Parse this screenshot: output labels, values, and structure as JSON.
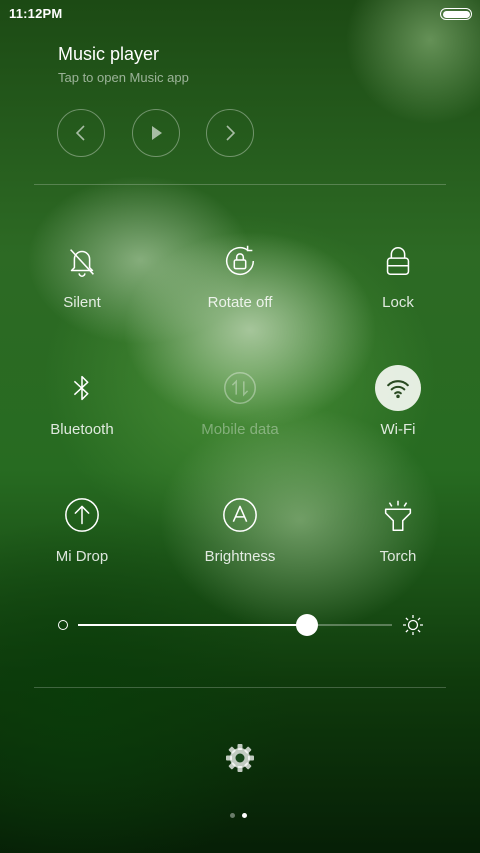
{
  "status_bar": {
    "time": "11:12PM",
    "battery_icon": "battery-full-icon"
  },
  "music": {
    "title": "Music player",
    "subtitle": "Tap to open Music app",
    "controls": [
      "previous-icon",
      "play-icon",
      "next-icon"
    ]
  },
  "tiles": [
    {
      "label": "Silent",
      "icon": "bell-off-icon",
      "state": "off"
    },
    {
      "label": "Rotate off",
      "icon": "rotate-lock-icon",
      "state": "off"
    },
    {
      "label": "Lock",
      "icon": "lock-icon",
      "state": "off"
    },
    {
      "label": "Bluetooth",
      "icon": "bluetooth-icon",
      "state": "off"
    },
    {
      "label": "Mobile data",
      "icon": "mobile-data-icon",
      "state": "disabled"
    },
    {
      "label": "Wi-Fi",
      "icon": "wifi-icon",
      "state": "on"
    },
    {
      "label": "Mi Drop",
      "icon": "mi-drop-icon",
      "state": "off"
    },
    {
      "label": "Brightness",
      "icon": "auto-brightness-icon",
      "state": "off"
    },
    {
      "label": "Torch",
      "icon": "torch-icon",
      "state": "off"
    }
  ],
  "brightness": {
    "level": 0.73,
    "min_icon": "brightness-low-icon",
    "max_icon": "brightness-high-icon"
  },
  "settings_icon": "gear-icon",
  "pager": {
    "pages": 2,
    "current": 2
  },
  "colors": {
    "active_tile_bg": "#f5f8f2",
    "text": "#ffffff"
  }
}
